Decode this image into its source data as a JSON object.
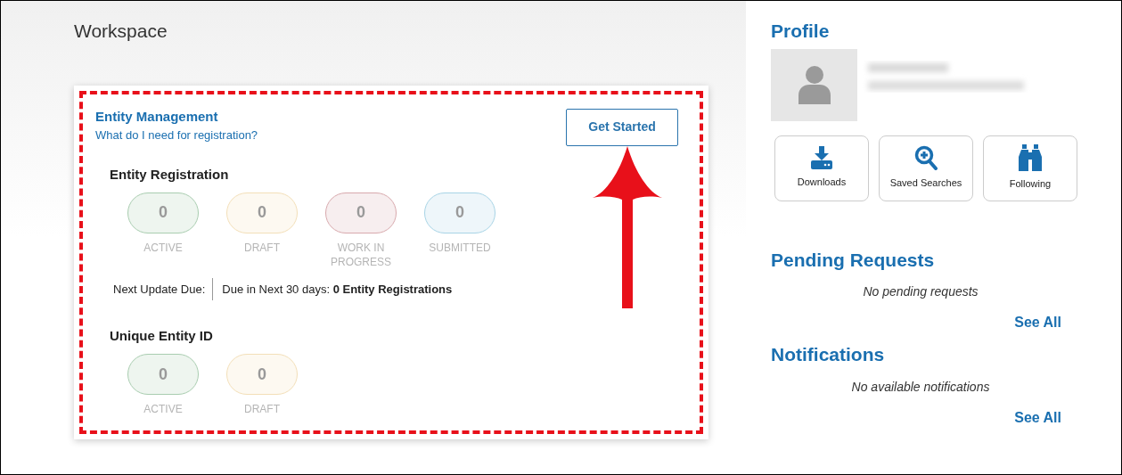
{
  "workspace": {
    "title": "Workspace",
    "card": {
      "title": "Entity Management",
      "link": "What do I need for registration?",
      "button": "Get Started",
      "sections": [
        {
          "title": "Entity Registration",
          "statuses": [
            {
              "count": "0",
              "label": "ACTIVE",
              "color": "#a9cdb0"
            },
            {
              "count": "0",
              "label": "DRAFT",
              "color": "#f3dfb8"
            },
            {
              "count": "0",
              "label": "WORK IN PROGRESS",
              "color": "#d8a9ad"
            },
            {
              "count": "0",
              "label": "SUBMITTED",
              "color": "#a8d4e6"
            }
          ],
          "update": {
            "label": "Next Update Due:",
            "text": "Due in Next 30 days: **0 Entity Registrations**"
          }
        },
        {
          "title": "Unique Entity ID",
          "statuses": [
            {
              "count": "0",
              "label": "ACTIVE",
              "color": "#a9cdb0"
            },
            {
              "count": "0",
              "label": "DRAFT",
              "color": "#f3dfb8"
            }
          ]
        }
      ]
    }
  },
  "profile": {
    "title": "Profile",
    "shortcuts": [
      {
        "label": "Downloads",
        "kind": "download"
      },
      {
        "label": "Saved Searches",
        "kind": "search"
      },
      {
        "label": "Following",
        "kind": "binoculars"
      }
    ]
  },
  "pending_requests": {
    "title": "Pending Requests",
    "empty": "No pending requests",
    "link": "See All"
  },
  "notifications": {
    "title": "Notifications",
    "empty": "No available notifications",
    "link": "See All"
  }
}
